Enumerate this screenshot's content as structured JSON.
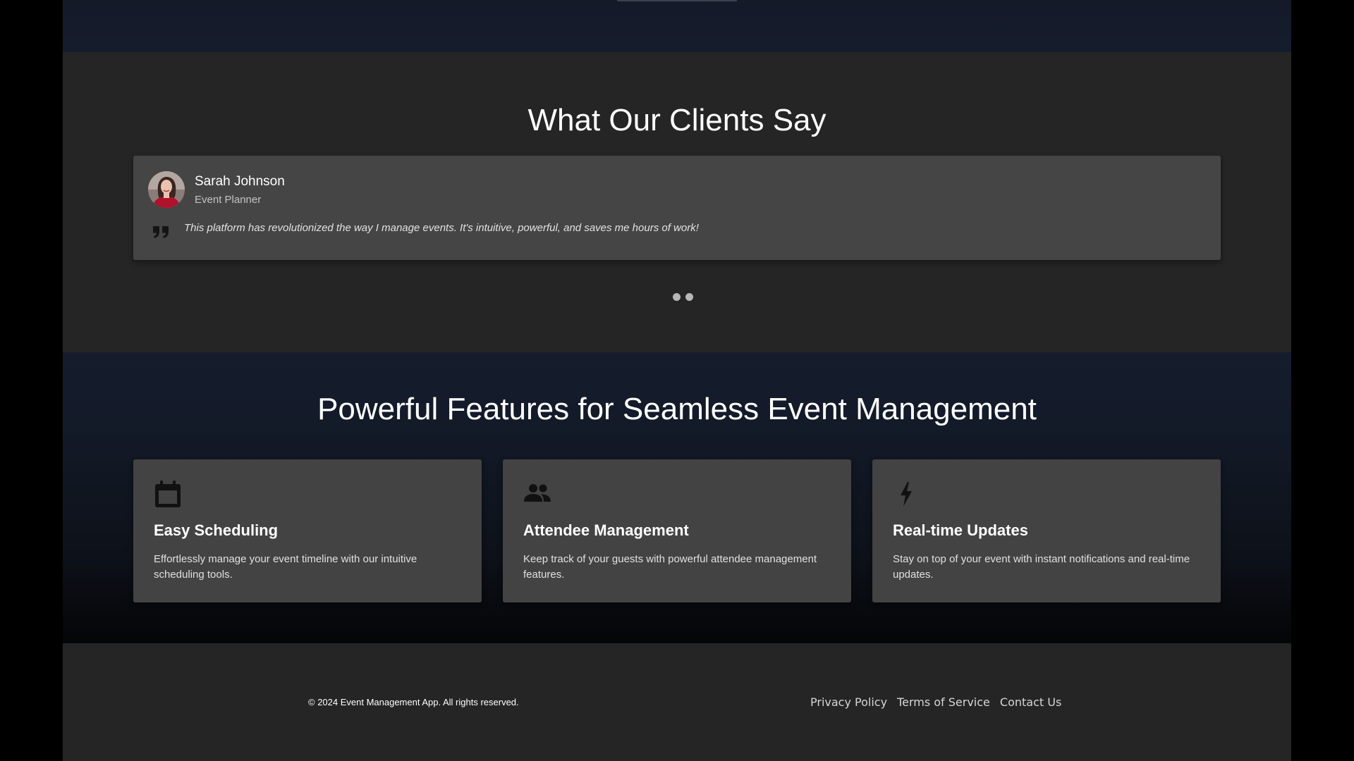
{
  "testimonials": {
    "title": "What Our Clients Say",
    "items": [
      {
        "name": "Sarah Johnson",
        "role": "Event Planner",
        "quote": "This platform has revolutionized the way I manage events. It's intuitive, powerful, and saves me hours of work!"
      }
    ],
    "dot_count": 2
  },
  "features": {
    "title": "Powerful Features for Seamless Event Management",
    "items": [
      {
        "icon": "calendar-icon",
        "title": "Easy Scheduling",
        "description": "Effortlessly manage your event timeline with our intuitive scheduling tools."
      },
      {
        "icon": "people-icon",
        "title": "Attendee Management",
        "description": "Keep track of your guests with powerful attendee management features."
      },
      {
        "icon": "lightning-icon",
        "title": "Real-time Updates",
        "description": "Stay on top of your event with instant notifications and real-time updates."
      }
    ]
  },
  "footer": {
    "copyright": "© 2024 Event Management App. All rights reserved.",
    "links": [
      "Privacy Policy",
      "Terms of Service",
      "Contact Us"
    ]
  },
  "colors": {
    "page_background": "#252525",
    "card_background": "#454545",
    "band_background": "#151c2d",
    "text_primary": "#ffffff"
  }
}
